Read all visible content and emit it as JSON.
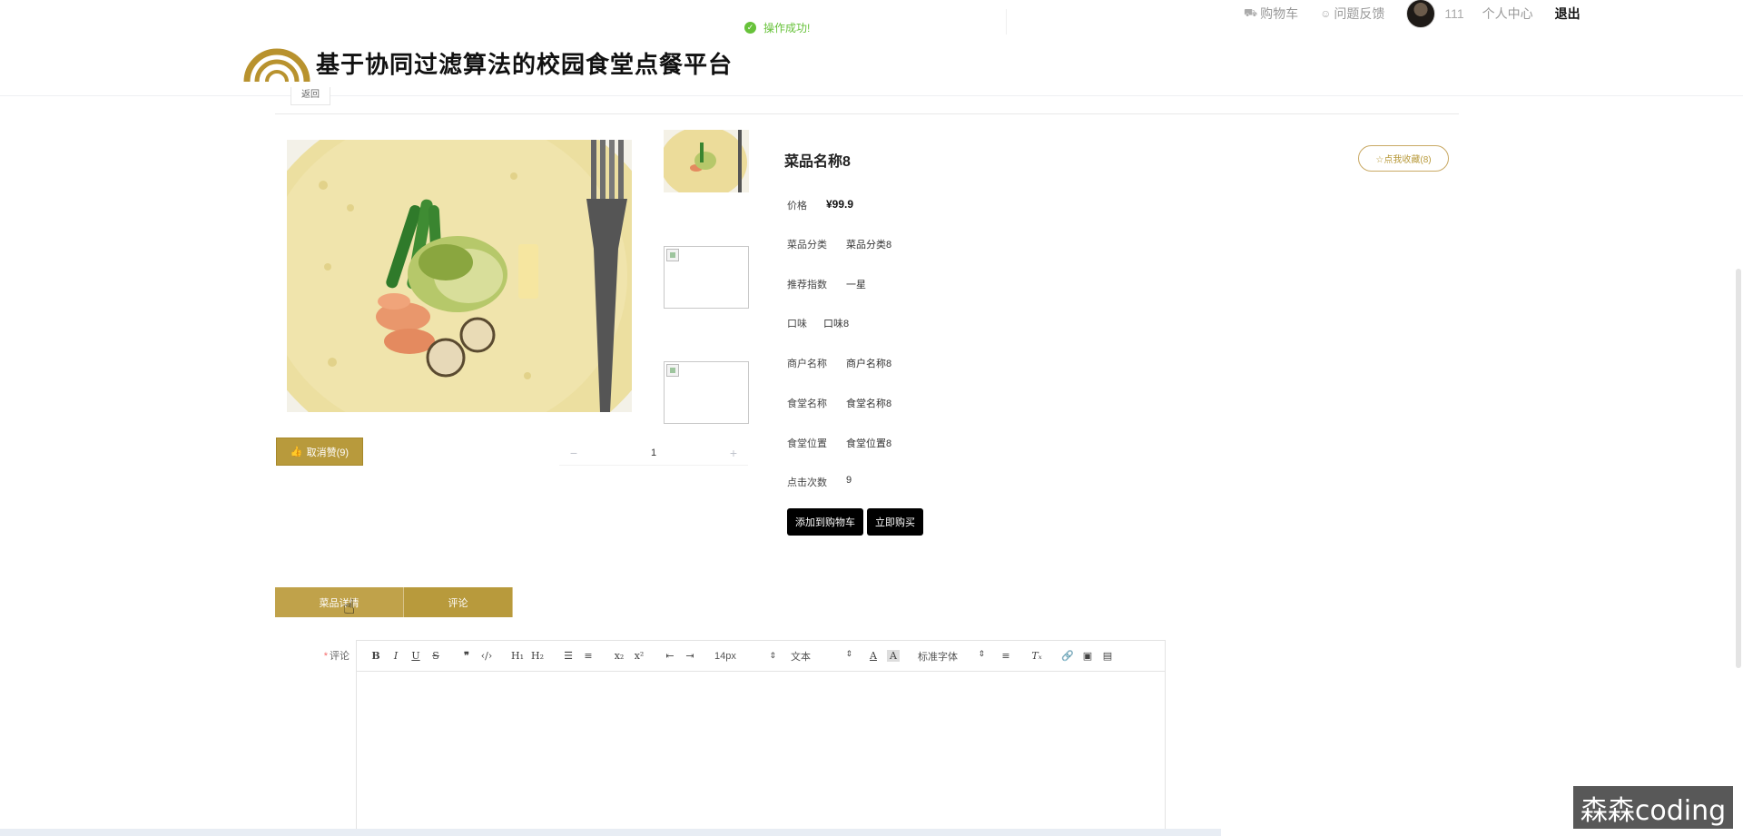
{
  "header": {
    "title": "基于协同过滤算法的校园食堂点餐平台",
    "toast": "操作成功!",
    "nav": {
      "cart": "购物车",
      "feedback": "问题反馈",
      "username": "111",
      "user_center": "个人中心",
      "logout": "退出"
    },
    "breadcrumb": "返回"
  },
  "product": {
    "title": "菜品名称8",
    "favorite_label": "☆点我收藏(8)",
    "like_label": "取消赞(9)",
    "quantity": "1",
    "fields": [
      {
        "label": "价格",
        "value": "¥99.9"
      },
      {
        "label": "菜品分类",
        "value": "菜品分类8"
      },
      {
        "label": "推荐指数",
        "value": "一星"
      },
      {
        "label": "口味",
        "value": "口味8"
      },
      {
        "label": "商户名称",
        "value": "商户名称8"
      },
      {
        "label": "食堂名称",
        "value": "食堂名称8"
      },
      {
        "label": "食堂位置",
        "value": "食堂位置8"
      },
      {
        "label": "点击次数",
        "value": "9"
      }
    ],
    "add_to_cart": "添加到购物车",
    "buy_now": "立即购买"
  },
  "tabs": [
    {
      "label": "菜品详情"
    },
    {
      "label": "评论"
    }
  ],
  "editor": {
    "label": "评论",
    "font_size": "14px",
    "block_type": "文本",
    "font_family": "标准字体"
  },
  "watermark": "森森coding",
  "colors": {
    "accent": "#b89a3c",
    "success": "#67c23a",
    "primary_button": "#000000"
  }
}
